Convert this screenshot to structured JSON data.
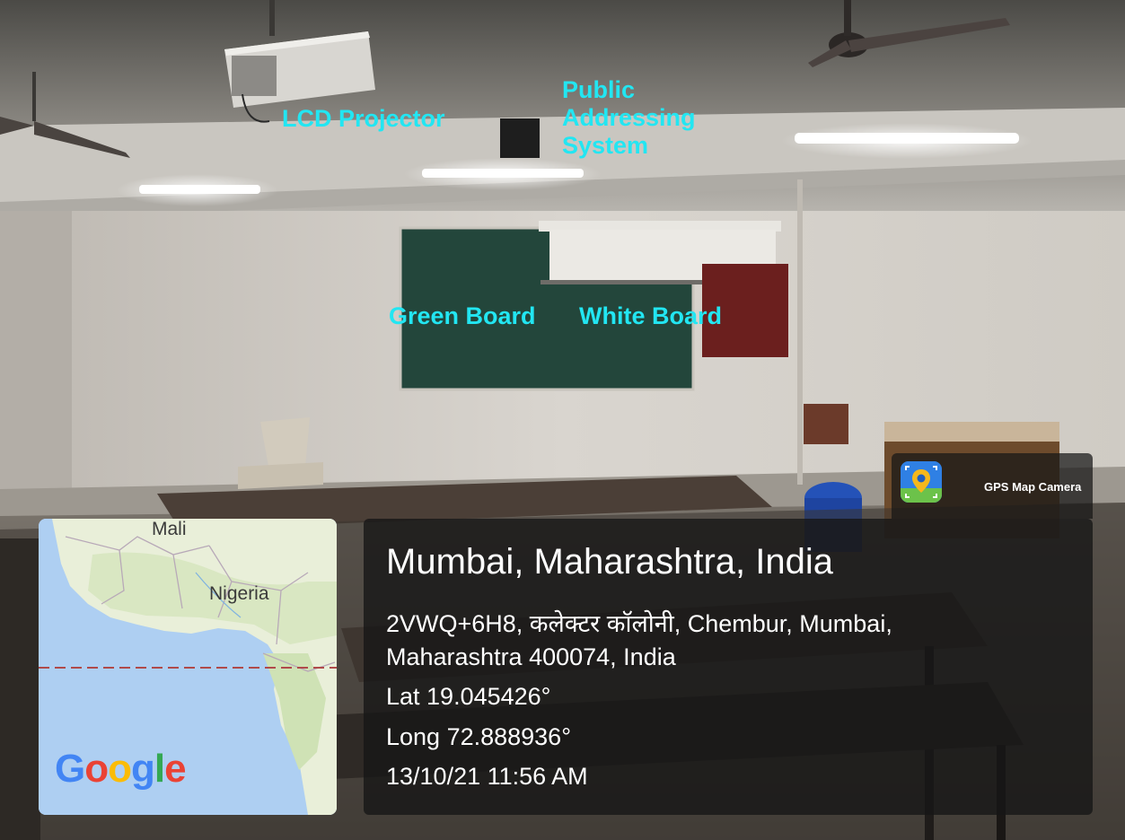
{
  "annotations": {
    "lcd_projector": "LCD Projector",
    "public_addressing": [
      "Public",
      "Addressing",
      "System"
    ],
    "green_board": "Green Board",
    "white_board": "White Board"
  },
  "map": {
    "label_1": "Mali",
    "label_2": "Nigeria",
    "logo_letters": [
      "G",
      "o",
      "o",
      "g",
      "l",
      "e"
    ],
    "logo_colors": [
      "#4285F4",
      "#EA4335",
      "#FBBC05",
      "#4285F4",
      "#34A853",
      "#EA4335"
    ]
  },
  "badge": {
    "label": "GPS Map Camera",
    "icon": "map-pin-icon"
  },
  "location": {
    "title": "Mumbai, Maharashtra, India",
    "address_line_1": "2VWQ+6H8, कलेक्टर कॉलोनी, Chembur, Mumbai,",
    "address_line_2": "Maharashtra 400074, India",
    "latitude": "Lat 19.045426°",
    "longitude": "Long 72.888936°",
    "timestamp": "13/10/21 11:56 AM"
  }
}
